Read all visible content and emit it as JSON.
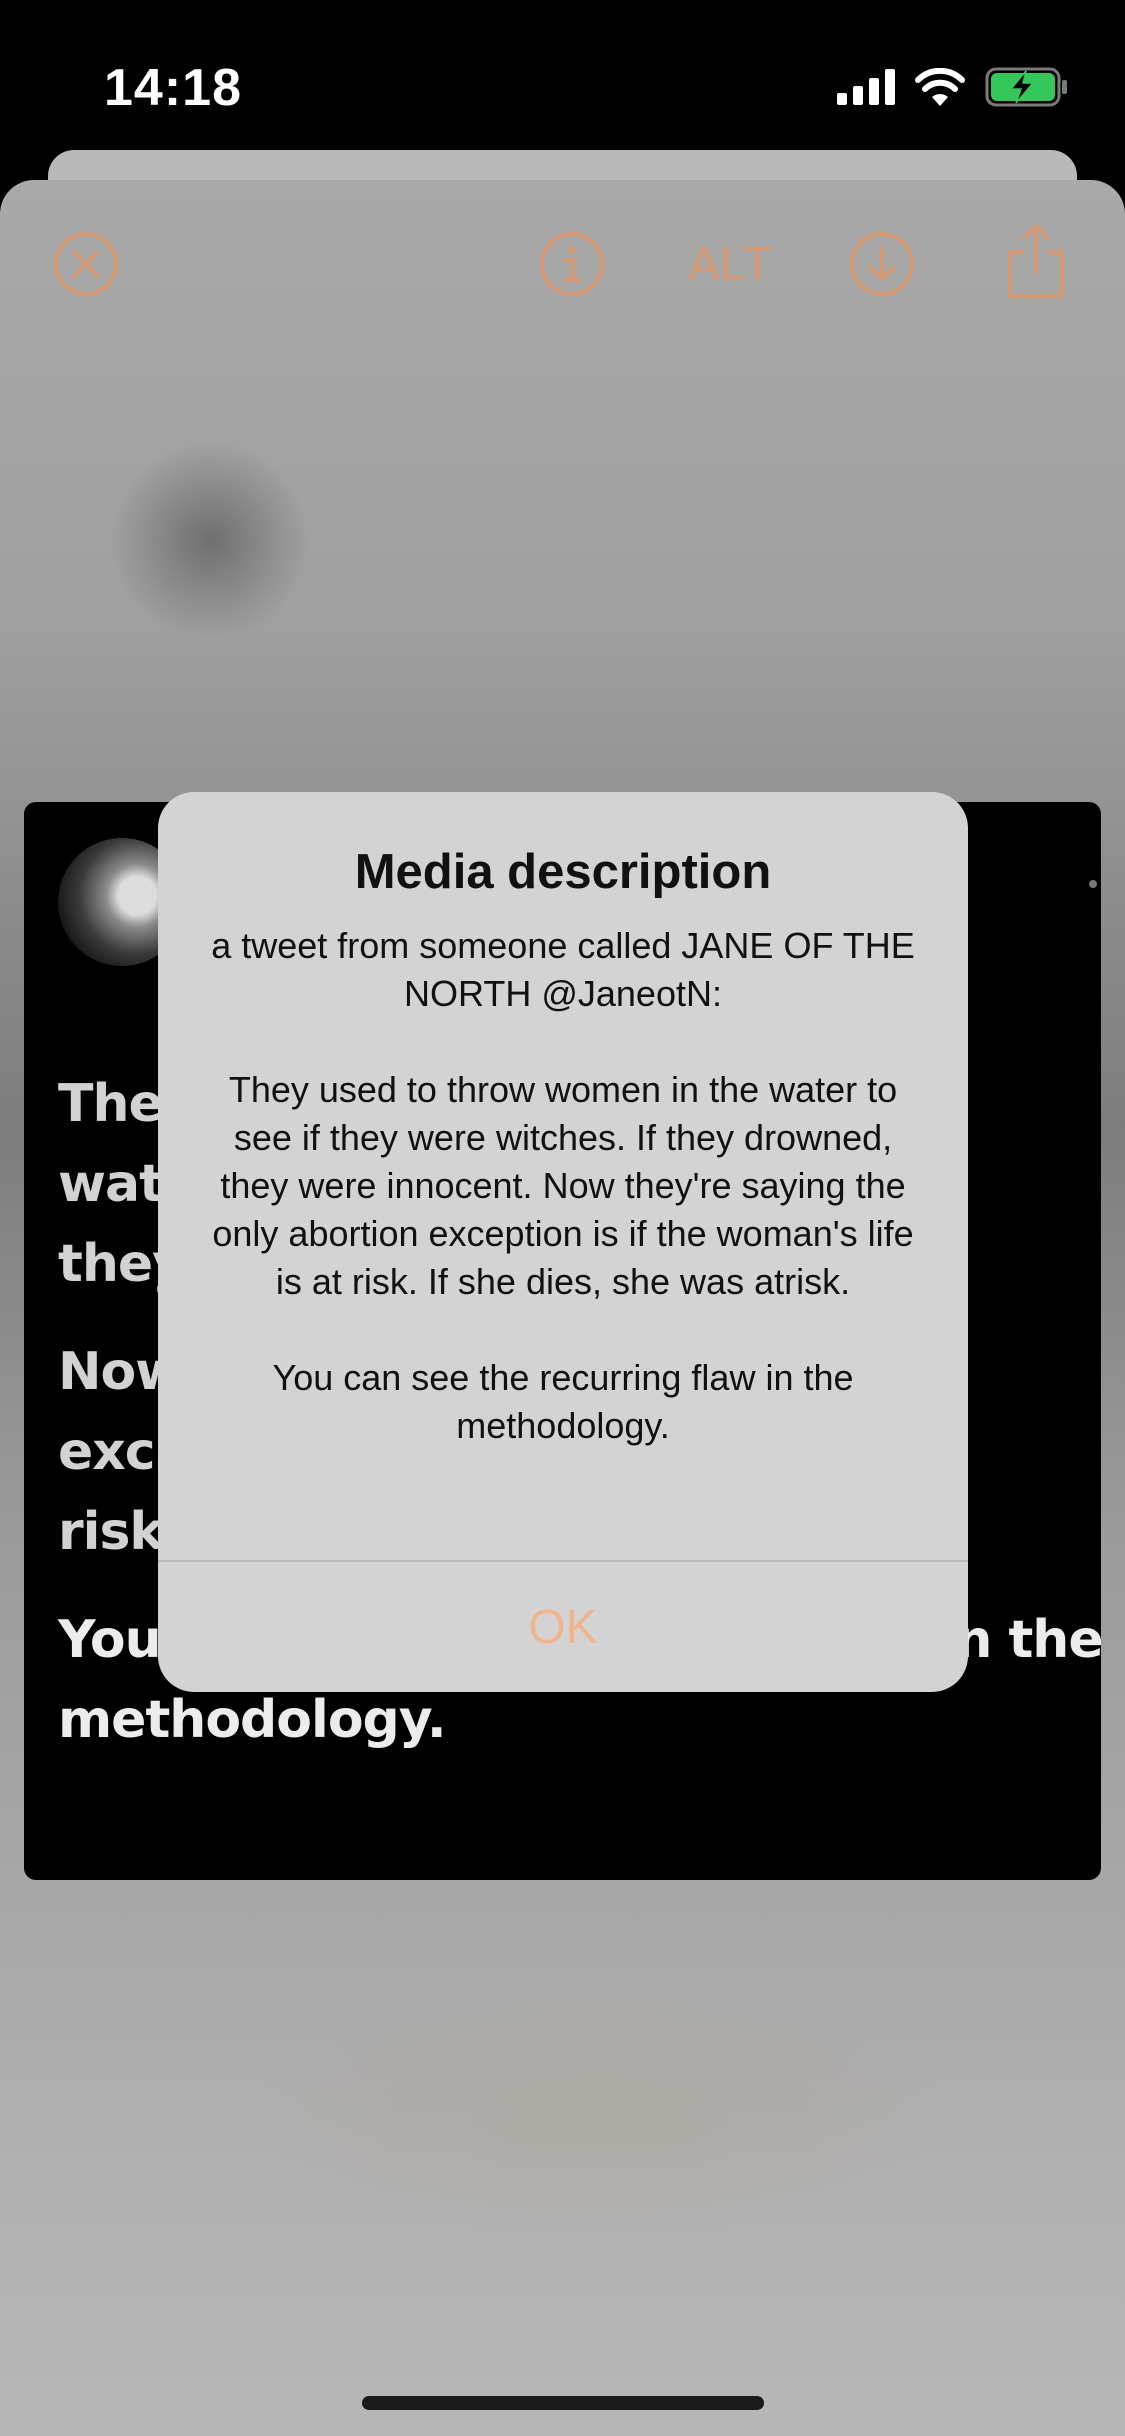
{
  "status_bar": {
    "time": "14:18",
    "icons": [
      "cellular-signal-icon",
      "wifi-icon",
      "battery-charging-icon"
    ]
  },
  "toolbar": {
    "close_icon": "close-circle-icon",
    "info_icon": "info-circle-icon",
    "alt_label": "ALT",
    "download_icon": "download-circle-icon",
    "share_icon": "share-icon",
    "accent_color": "#d59a74"
  },
  "tweet": {
    "paragraphs": [
      "The\nwat                                    s. If\nthey                                      nt.",
      "Now                                      rtion\nexc                                     s at\nrisk",
      "You can see the recurring flaw in the\nmethodology."
    ]
  },
  "alert": {
    "title": "Media description",
    "message": "a tweet from someone called JANE OF THE NORTH @JaneotN:\n\nThey used to throw women in the water to see if they were witches. If they drowned, they were innocent. Now they're saying the only abortion exception is if the woman's life is at risk. If she dies, she was atrisk.\n\nYou can see the recurring flaw in the methodology.",
    "ok_label": "OK",
    "ok_color": "#f1b58d"
  }
}
